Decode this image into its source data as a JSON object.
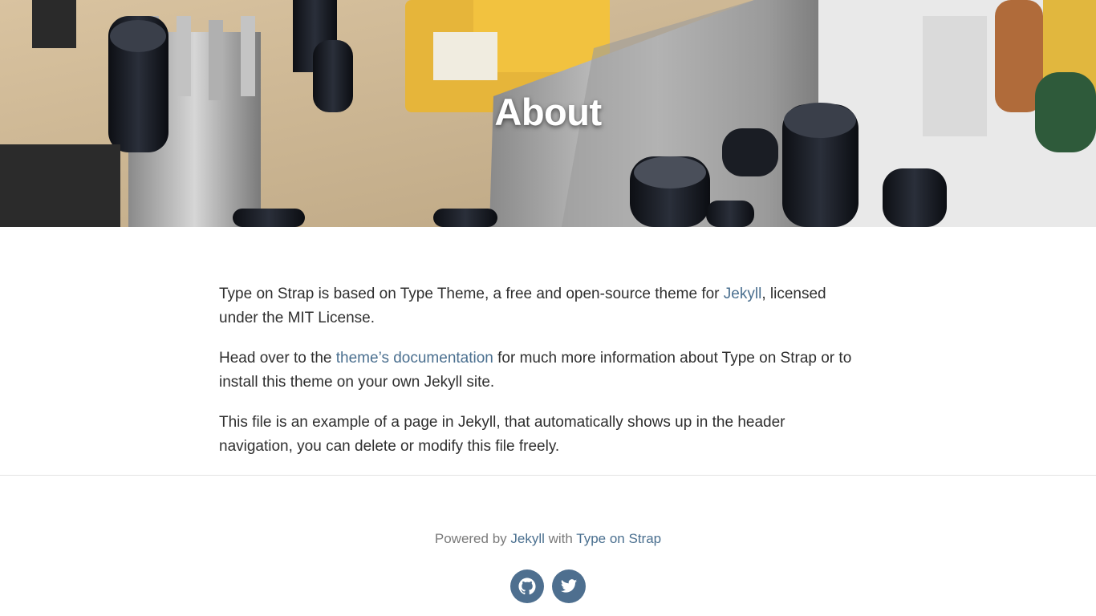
{
  "page": {
    "title": "About"
  },
  "content": {
    "p1_before": "Type on Strap is based on Type Theme, a free and open-source theme for ",
    "p1_link": "Jekyll",
    "p1_after": ", licensed under the MIT License.",
    "p2_before": "Head over to the ",
    "p2_link": "theme’s documentation",
    "p2_after": " for much more information about Type on Strap or to install this theme on your own Jekyll site.",
    "p3": "This file is an example of a page in Jekyll, that automatically shows up in the header navigation, you can delete or modify this file freely."
  },
  "footer": {
    "powered_by": "Powered by ",
    "jekyll_link": "Jekyll",
    "with": " with ",
    "theme_link": "Type on Strap",
    "icons": [
      "github-icon",
      "twitter-icon"
    ]
  },
  "colors": {
    "link": "#4a6f8f",
    "social_circle": "#4e6f8f"
  }
}
